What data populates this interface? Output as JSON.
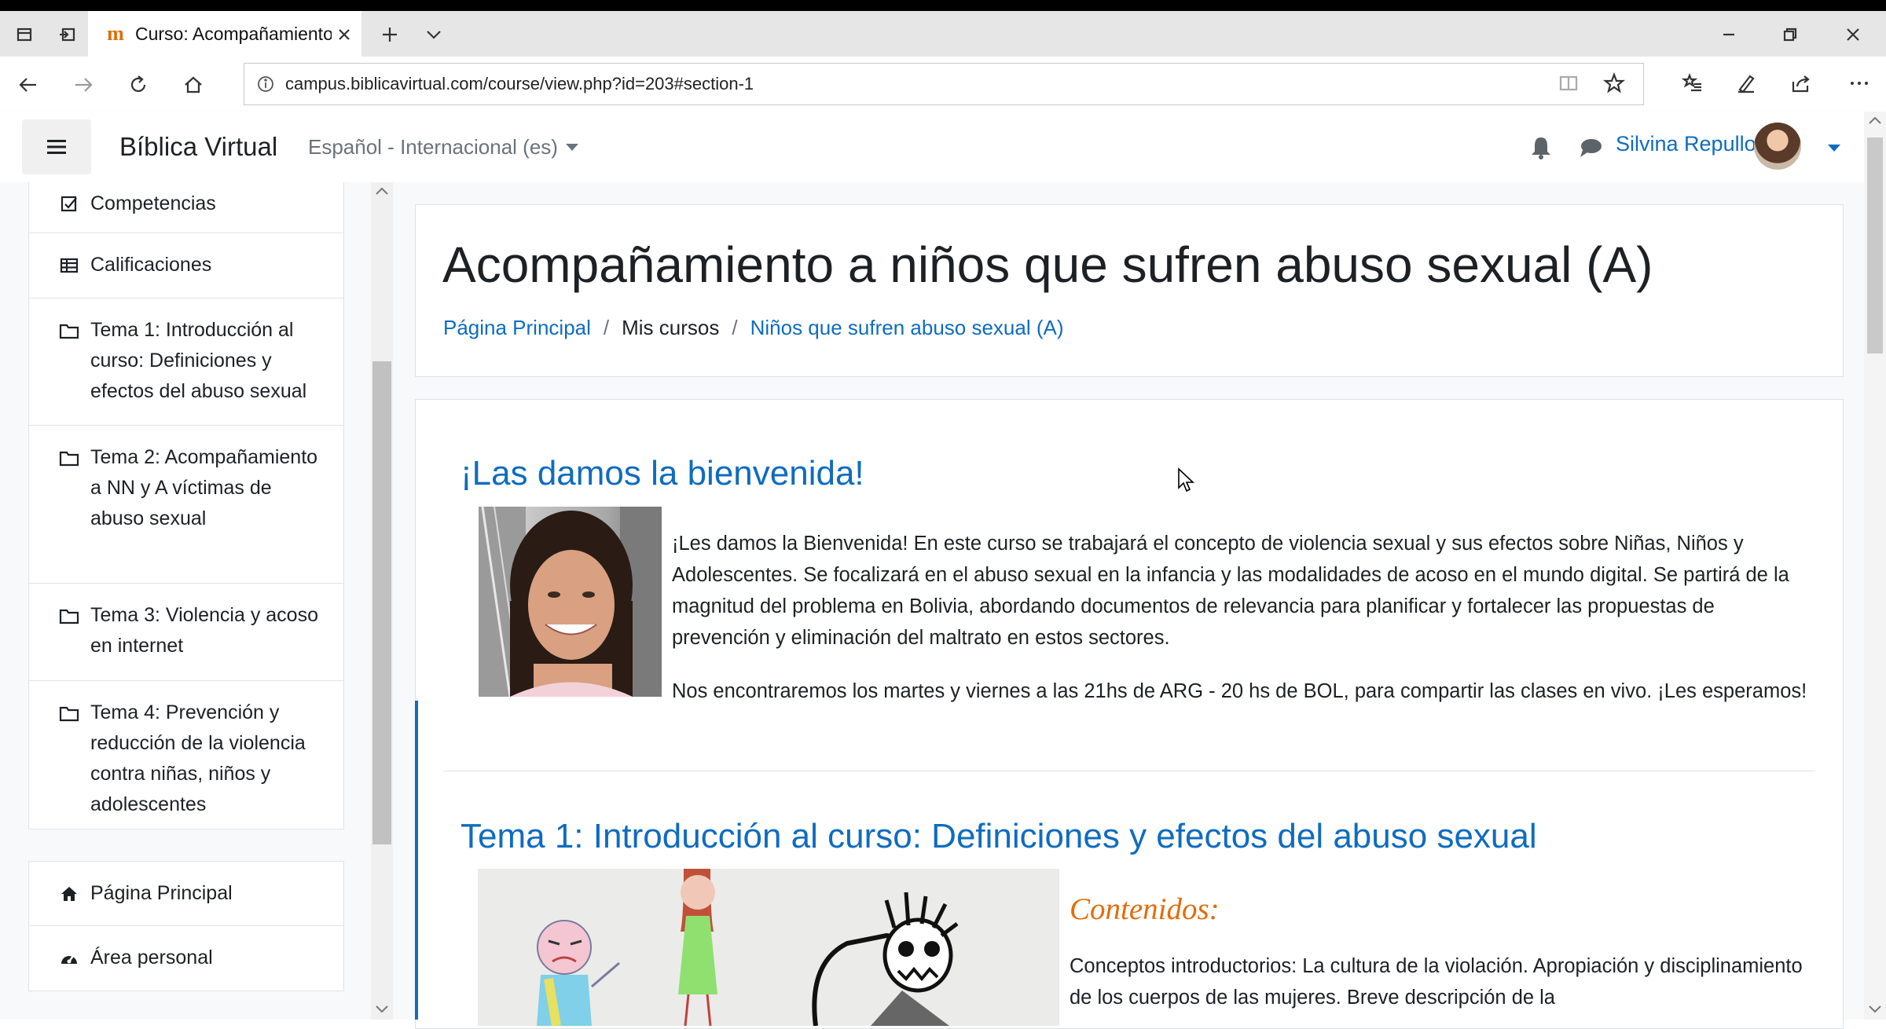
{
  "browser": {
    "tab_title": "Curso: Acompañamiento",
    "url": "campus.biblicavirtual.com/course/view.php?id=203#section-1"
  },
  "header": {
    "brand": "Bíblica Virtual",
    "language": "Español - Internacional (es)",
    "user_name": "Silvina Repullo"
  },
  "drawer": {
    "course_items": [
      {
        "label": "Competencias",
        "icon": "checkbox-icon"
      },
      {
        "label": "Calificaciones",
        "icon": "table-icon"
      },
      {
        "label": "Tema 1: Introducción al curso: Definiciones y efectos del abuso sexual",
        "icon": "folder-icon"
      },
      {
        "label": "Tema 2: Acompañamiento a NN y A víctimas de abuso sexual",
        "icon": "folder-icon"
      },
      {
        "label": "Tema 3: Violencia y acoso en internet",
        "icon": "folder-icon"
      },
      {
        "label": "Tema 4: Prevención y reducción de la violencia contra niñas, niños y adolescentes",
        "icon": "folder-icon"
      }
    ],
    "site_items": [
      {
        "label": "Página Principal",
        "icon": "home-icon"
      },
      {
        "label": "Área personal",
        "icon": "dashboard-icon"
      }
    ]
  },
  "page": {
    "title": "Acompañamiento a niños que sufren abuso sexual (A)",
    "breadcrumb": {
      "home": "Página Principal",
      "sep": "/",
      "courses": "Mis cursos",
      "course": "Niños que sufren abuso sexual (A)"
    }
  },
  "sections": {
    "welcome_title": "¡Las damos la bienvenida!",
    "welcome_p1": "¡Les damos la Bienvenida! En este curso se trabajará el concepto de violencia sexual y sus efectos  sobre Niñas, Niños y Adolescentes.  Se focalizará en el abuso  sexual  en la infancia y las modalidades de acoso  en el mundo digital.  Se  partirá de la magnitud del problema en Bolivia, abordando  documentos de relevancia para  planificar y fortalecer  las propuestas de prevención y eliminación del maltrato en estos sectores.",
    "welcome_p2": "Nos encontraremos los martes y viernes a las 21hs de ARG -  20 hs de BOL, para compartir las clases en vivo. ¡Les esperamos!",
    "tema1_title": "Tema 1: Introducción al curso: Definiciones y efectos del abuso sexual",
    "contenidos_heading": "Contenidos:",
    "contenidos_text": "Conceptos introductorios: La cultura de la violación. Apropiación y disciplinamiento de los cuerpos de las mujeres. Breve descripción de la"
  },
  "colors": {
    "link": "#0f6cbf",
    "accent": "#e36c0a",
    "text": "#1d2125"
  }
}
